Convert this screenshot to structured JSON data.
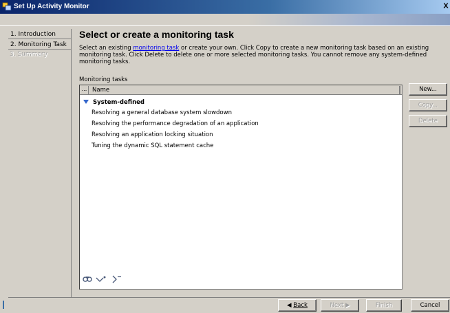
{
  "window": {
    "title": "Set Up Activity Monitor",
    "close_glyph": "X"
  },
  "nav": {
    "items": [
      {
        "label": "1. Introduction",
        "state": "normal"
      },
      {
        "label": "2. Monitoring Task",
        "state": "active"
      },
      {
        "label": "3. Summary",
        "state": "disabled"
      }
    ]
  },
  "main": {
    "heading": "Select or create a monitoring task",
    "desc_before": "Select an existing ",
    "desc_link": "monitoring task",
    "desc_after": " or create your own. Click Copy to create a new monitoring task based on an existing monitoring task. Click Delete to delete one or more selected monitoring tasks. You cannot remove any system-defined monitoring tasks.",
    "list_label": "Monitoring tasks",
    "column_corner": "...",
    "column_name": "Name",
    "group_label": "System-defined",
    "tasks": [
      "Resolving a general database system slowdown",
      "Resolving the performance degradation of an application",
      "Resolving an application locking situation",
      "Tuning the dynamic SQL statement cache"
    ],
    "toolbar_icons": [
      "find-icon",
      "expand-icon",
      "collapse-icon"
    ]
  },
  "side_buttons": {
    "new": "New...",
    "copy": "Copy...",
    "delete": "Delete"
  },
  "footer": {
    "back": "Back",
    "next": "Next",
    "finish": "Finish",
    "cancel": "Cancel"
  },
  "colors": {
    "title_gradient_start": "#0a246a",
    "link": "#0000ee",
    "expand_triangle": "#3366cc"
  }
}
